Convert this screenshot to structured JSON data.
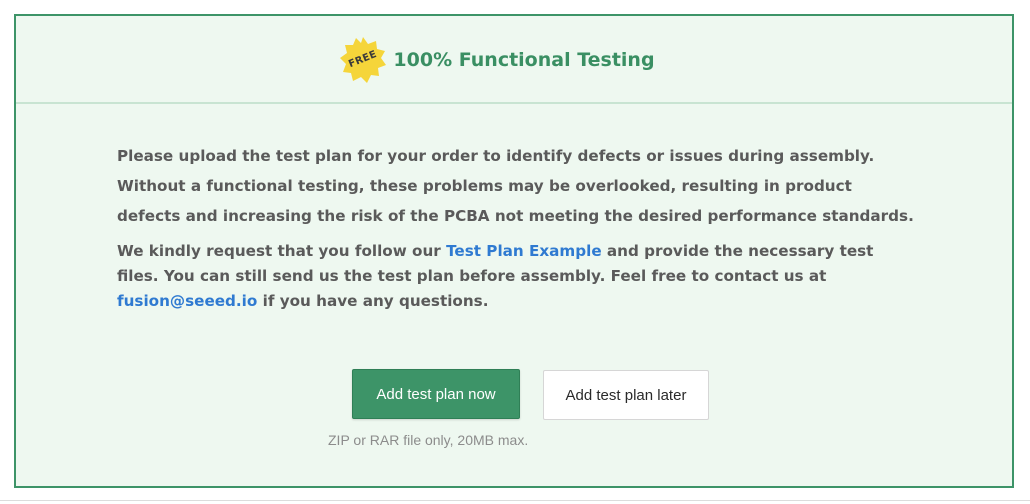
{
  "header": {
    "badge_label": "FREE",
    "title": "100% Functional Testing"
  },
  "body": {
    "paragraph1": "Please upload the test plan for your order to identify defects or issues during assembly. Without a functional testing, these problems may be overlooked, resulting in product defects and increasing the risk of the PCBA not meeting the desired performance standards.",
    "paragraph2_before_link": "We kindly request that you follow our ",
    "test_plan_link": "Test Plan Example",
    "paragraph2_middle": " and provide the necessary test files. You can still send us the test plan before assembly. Feel free to contact us at ",
    "email_link": "fusion@seeed.io",
    "paragraph2_after": " if you have any questions."
  },
  "actions": {
    "primary_label": "Add test plan now",
    "secondary_label": "Add test plan later",
    "hint": "ZIP or RAR file only, 20MB max."
  },
  "colors": {
    "accent": "#3d9468",
    "panel_bg": "#eef8f0",
    "badge": "#f5d53a",
    "link": "#2f7ad1"
  }
}
